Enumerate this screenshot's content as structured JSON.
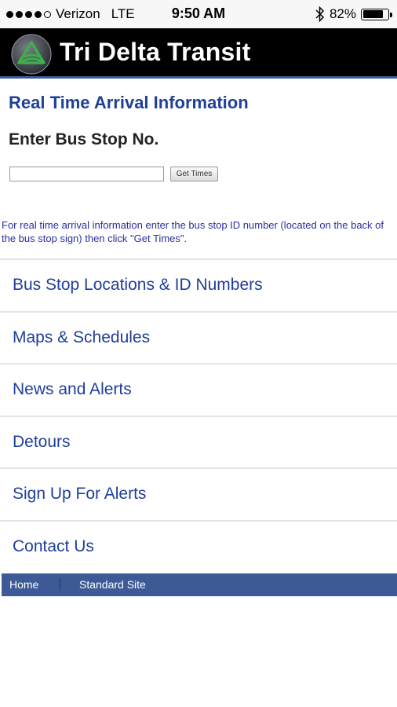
{
  "status_bar": {
    "carrier": "Verizon",
    "network": "LTE",
    "time": "9:50 AM",
    "battery": "82%",
    "battery_level": 0.82,
    "signal_dots_filled": 4,
    "signal_dots_total": 5
  },
  "header": {
    "title": "Tri Delta Transit",
    "logo_icon": "tri-delta-logo-icon"
  },
  "realtime": {
    "title": "Real Time Arrival Information",
    "subtitle": "Enter Bus Stop No.",
    "input_value": "",
    "button_label": "Get Times",
    "help_text": "For real time arrival information enter the bus stop ID number (located on the back of the bus stop sign) then click \"Get Times\"."
  },
  "menu": {
    "items": [
      {
        "label": "Bus Stop Locations & ID Numbers"
      },
      {
        "label": "Maps & Schedules"
      },
      {
        "label": "News and Alerts"
      },
      {
        "label": "Detours"
      },
      {
        "label": "Sign Up For Alerts"
      },
      {
        "label": "Contact Us"
      }
    ]
  },
  "footer": {
    "home": "Home",
    "standard_site": "Standard Site"
  },
  "colors": {
    "link_blue": "#1f3f99",
    "footer_blue": "#3d5a97",
    "header_black": "#000000"
  }
}
